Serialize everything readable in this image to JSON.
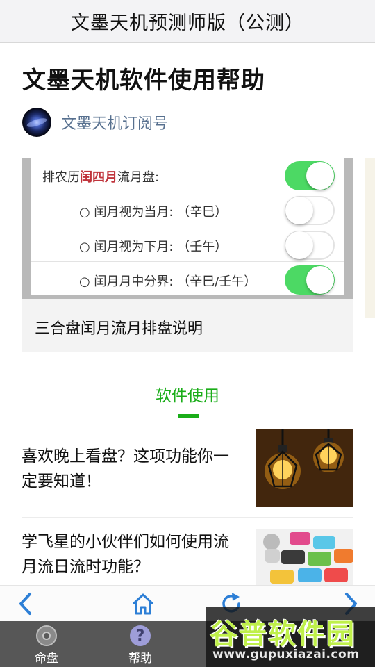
{
  "header": {
    "title": "文墨天机预测师版（公测）"
  },
  "article": {
    "title": "文墨天机软件使用帮助",
    "author": "文墨天机订阅号"
  },
  "card": {
    "settings": [
      {
        "prefix": "排农历",
        "highlight": "闰四月",
        "suffix": "流月盘:",
        "toggle": "on"
      },
      {
        "prefix": "○ 闰月视为当月:  （辛巳）",
        "highlight": "",
        "suffix": "",
        "toggle": "off"
      },
      {
        "prefix": "○ 闰月视为下月:  （壬午）",
        "highlight": "",
        "suffix": "",
        "toggle": "off"
      },
      {
        "prefix": "○ 闰月月中分界:  （辛巳/壬午）",
        "highlight": "",
        "suffix": "",
        "toggle": "on"
      }
    ],
    "caption": "三合盘闰月流月排盘说明"
  },
  "section_tab": {
    "label": "软件使用"
  },
  "list": [
    {
      "text": "喜欢晚上看盘？这项功能你一定要知道！",
      "thumb": "light-bulbs-image"
    },
    {
      "text": "学飞星的小伙伴们如何使用流月流日流时功能？",
      "thumb": "app-keyboard-image"
    }
  ],
  "browser_nav": {
    "back_icon": "chevron-left-icon",
    "home_icon": "home-icon",
    "refresh_icon": "refresh-icon",
    "forward_icon": "chevron-right-icon"
  },
  "tabbar": {
    "items": [
      {
        "label": "命盘",
        "icon": "disc-icon"
      },
      {
        "label": "帮助",
        "icon": "help-icon"
      }
    ]
  },
  "watermark": {
    "brand": "谷普软件园",
    "url": "www.gupuxiazai.com"
  },
  "colors": {
    "accent_green": "#1aad19",
    "toggle_on": "#4cd964",
    "link_blue": "#2d7fd6",
    "tabbar_bg": "#575757"
  }
}
